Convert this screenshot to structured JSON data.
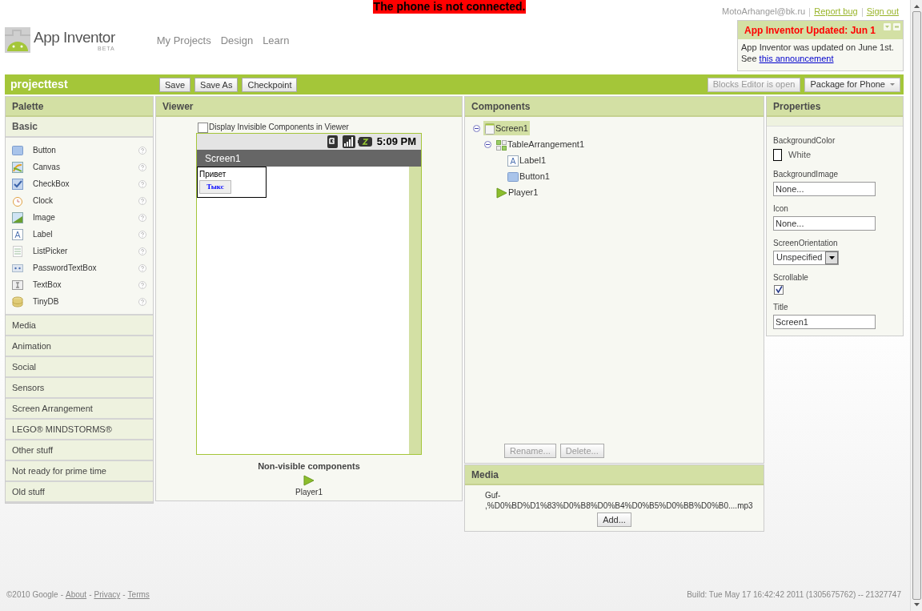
{
  "banner": "The phone is not connected.",
  "user": {
    "email": "MotoArhangel@bk.ru",
    "links": [
      "Report bug",
      "Sign out"
    ]
  },
  "logo": {
    "name": "App Inventor",
    "tag": "BETA"
  },
  "nav": [
    "My Projects",
    "Design",
    "Learn"
  ],
  "notice": {
    "title": "App Inventor Updated: Jun 1",
    "text": "App Inventor was updated on June 1st.",
    "see": "See",
    "link": "this announcement"
  },
  "project": {
    "name": "projecttest",
    "buttons": [
      "Save",
      "Save As",
      "Checkpoint"
    ],
    "right_buttons": [
      {
        "label": "Blocks Editor is open",
        "disabled": true,
        "dropdown": false
      },
      {
        "label": "Package for Phone",
        "disabled": false,
        "dropdown": true
      }
    ]
  },
  "palette": {
    "title": "Palette",
    "drawers": [
      {
        "label": "Basic",
        "expanded": true,
        "items": [
          {
            "name": "Button",
            "kind": "button"
          },
          {
            "name": "Canvas",
            "kind": "canvas"
          },
          {
            "name": "CheckBox",
            "kind": "checkbox"
          },
          {
            "name": "Clock",
            "kind": "clock"
          },
          {
            "name": "Image",
            "kind": "image"
          },
          {
            "name": "Label",
            "kind": "label"
          },
          {
            "name": "ListPicker",
            "kind": "list"
          },
          {
            "name": "PasswordTextBox",
            "kind": "password"
          },
          {
            "name": "TextBox",
            "kind": "textbox"
          },
          {
            "name": "TinyDB",
            "kind": "db"
          }
        ]
      },
      {
        "label": "Media",
        "expanded": false
      },
      {
        "label": "Animation",
        "expanded": false
      },
      {
        "label": "Social",
        "expanded": false
      },
      {
        "label": "Sensors",
        "expanded": false
      },
      {
        "label": "Screen Arrangement",
        "expanded": false
      },
      {
        "label": "LEGO® MINDSTORMS®",
        "expanded": false
      },
      {
        "label": "Other stuff",
        "expanded": false
      },
      {
        "label": "Not ready for prime time",
        "expanded": false
      },
      {
        "label": "Old stuff",
        "expanded": false
      }
    ]
  },
  "viewer": {
    "title": "Viewer",
    "invisible_checkbox": {
      "label": "Display Invisible Components in Viewer",
      "checked": false
    },
    "phone": {
      "time": "5:09 PM",
      "screen_title": "Screen1",
      "label": "Привет",
      "button": "Тыкс"
    },
    "nonvisible_title": "Non-visible components",
    "nonvisible": [
      "Player1"
    ]
  },
  "components": {
    "title": "Components",
    "tree": [
      {
        "name": "Screen1",
        "kind": "screen",
        "selected": true,
        "expanded": true,
        "children": [
          {
            "name": "TableArrangement1",
            "kind": "table",
            "selected": false,
            "expanded": true,
            "children": [
              {
                "name": "Label1",
                "kind": "label",
                "selected": false
              },
              {
                "name": "Button1",
                "kind": "button",
                "selected": false
              }
            ]
          },
          {
            "name": "Player1",
            "kind": "player",
            "selected": false
          }
        ]
      }
    ],
    "buttons": [
      "Rename...",
      "Delete..."
    ]
  },
  "media": {
    "title": "Media",
    "files": [
      {
        "lines": [
          "Guf-",
          ",%D0%BD%D1%83%D0%B8%D0%B4%D0%B5%D0%BB%D0%B0....mp3"
        ]
      }
    ],
    "button": "Add..."
  },
  "properties": {
    "title": "Properties",
    "items": [
      {
        "label": "BackgroundColor",
        "kind": "color",
        "value": "White",
        "color": "#ffffff"
      },
      {
        "label": "BackgroundImage",
        "kind": "text",
        "value": "None..."
      },
      {
        "label": "Icon",
        "kind": "text",
        "value": "None..."
      },
      {
        "label": "ScreenOrientation",
        "kind": "select",
        "value": "Unspecified"
      },
      {
        "label": "Scrollable",
        "kind": "checkbox",
        "checked": true
      },
      {
        "label": "Title",
        "kind": "text",
        "value": "Screen1"
      }
    ]
  },
  "footer": {
    "copyright": "©2010 Google",
    "separator": "-",
    "links": [
      "About",
      "Privacy",
      "Terms"
    ],
    "build": "Build: Tue May 17 16:42:42 2011 (1305675762) -- 21327747"
  }
}
